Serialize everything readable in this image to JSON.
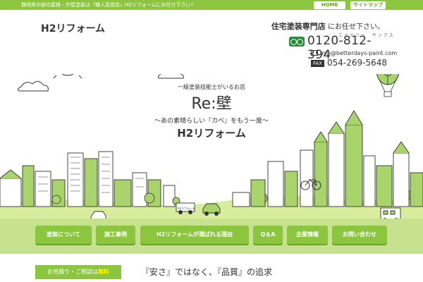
{
  "topbar": {
    "message": "静岡県中部の屋根・外壁塗装は『職人直営店』H2リフォームにお任せ下さい！",
    "home_label": "HOME",
    "sitemap_label": "サイトマップ"
  },
  "header": {
    "logo_small": "H2リフォーム",
    "specialty_prefix": "住宅塗装専門店",
    "specialty_suffix": "にお任せ下さい。",
    "tel_reading": "エイテツー　サンクス",
    "tel": "0120-812-394",
    "email": "info@betterdays-paint.com",
    "fax_label": "FAX",
    "fax": "054-269-5648"
  },
  "hero": {
    "cert_line": "一級塗装技能士がいるお店",
    "brand": "Re:壁",
    "tagline": "〜あの素晴らしい『カベ』をもう一度〜",
    "company": "H2リフォーム",
    "car_label": "h2リフォーム"
  },
  "nav": {
    "items": [
      {
        "label": "塗装について"
      },
      {
        "label": "施工事例"
      },
      {
        "label": "H2リフォームが選ばれる理由"
      },
      {
        "label": "Q＆A"
      },
      {
        "label": "企業情報"
      },
      {
        "label": "お問い合わせ"
      }
    ]
  },
  "footer": {
    "quote_text": "お見積り・ご相談は",
    "quote_free": "無料",
    "headline": "『安さ』ではなく、『品質』の追求"
  },
  "colors": {
    "accent": "#8cc63f",
    "accent_dark": "#6aa42a",
    "band": "#c6e28e",
    "ground": "#d7ec9c"
  }
}
